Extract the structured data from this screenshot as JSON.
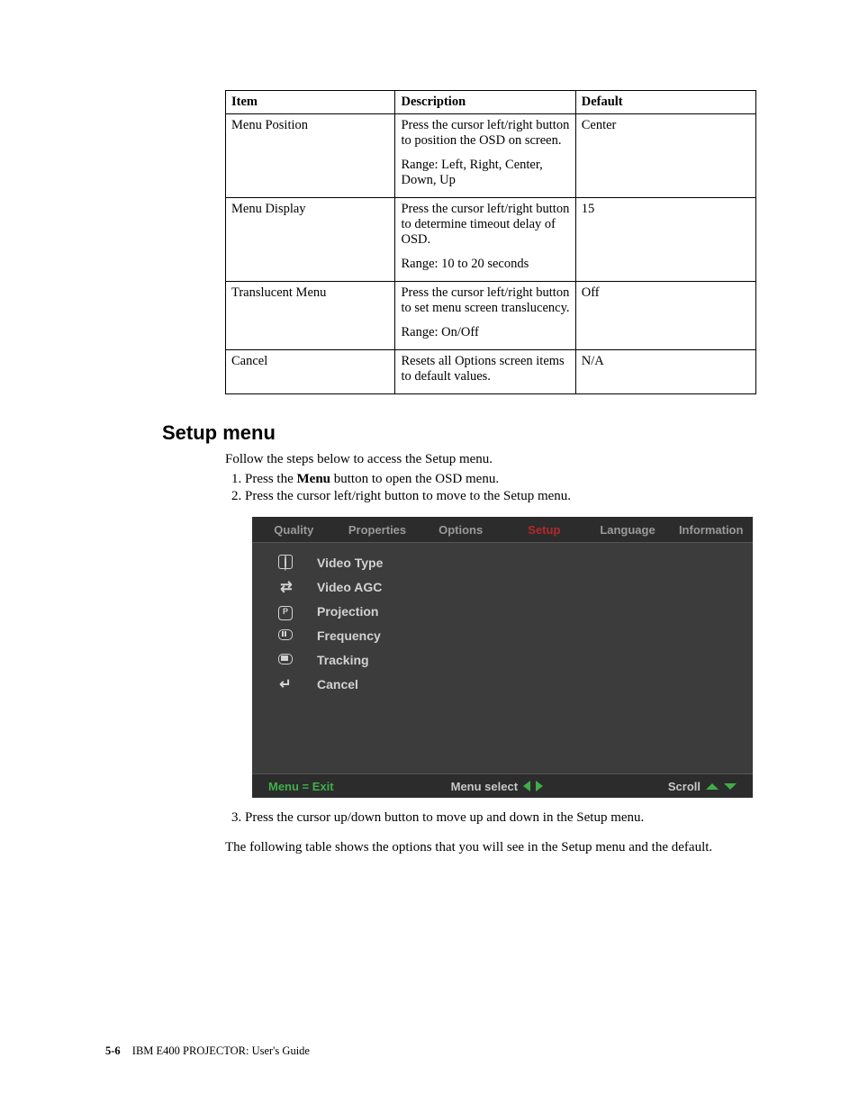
{
  "table": {
    "headers": {
      "item": "Item",
      "description": "Description",
      "default": "Default"
    },
    "rows": [
      {
        "item": "Menu Position",
        "desc1": "Press the cursor left/right button to position the OSD on screen.",
        "desc2": "Range: Left, Right, Center, Down, Up",
        "default": "Center"
      },
      {
        "item": "Menu Display",
        "desc1": "Press the cursor left/right button to determine timeout delay of OSD.",
        "desc2": "Range: 10 to 20 seconds",
        "default": "15"
      },
      {
        "item": "Translucent Menu",
        "desc1": "Press the cursor left/right button to set menu screen translucency.",
        "desc2": "Range: On/Off",
        "default": "Off"
      },
      {
        "item": "Cancel",
        "desc1": "Resets all Options screen items to default values.",
        "desc2": "",
        "default": "N/A"
      }
    ]
  },
  "section": {
    "heading": "Setup menu",
    "intro": "Follow the steps below to access the Setup menu.",
    "step1_pre": "Press the ",
    "step1_bold": "Menu",
    "step1_post": " button to open the OSD menu.",
    "step2": "Press the cursor left/right button to move to the Setup menu."
  },
  "osd": {
    "tabs": [
      "Quality",
      "Properties",
      "Options",
      "Setup",
      "Language",
      "Information"
    ],
    "active_tab_index": 3,
    "items": [
      {
        "label": "Video Type",
        "icon": "target"
      },
      {
        "label": "Video AGC",
        "icon": "arrows"
      },
      {
        "label": "Projection",
        "icon": "p"
      },
      {
        "label": "Frequency",
        "icon": "freq"
      },
      {
        "label": "Tracking",
        "icon": "track"
      },
      {
        "label": "Cancel",
        "icon": "return"
      }
    ],
    "footer": {
      "menu_exit": "Menu = Exit",
      "menu_select": "Menu select",
      "scroll": "Scroll"
    }
  },
  "after": {
    "step3": "Press the cursor up/down button to move up and down in the Setup menu.",
    "closing": "The following table shows the options that you will see in the Setup menu and the default."
  },
  "footer": {
    "page_number": "5-6",
    "doc_title": "IBM E400 PROJECTOR: User's Guide"
  }
}
